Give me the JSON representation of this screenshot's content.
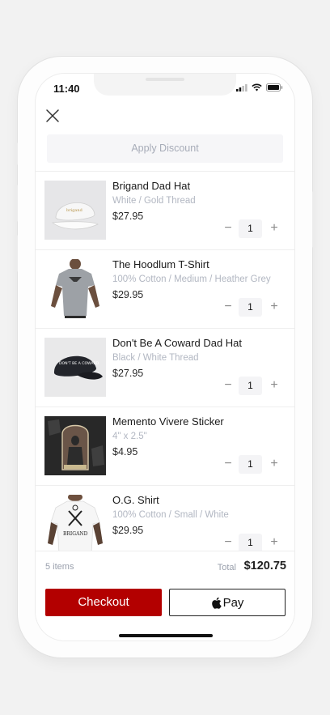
{
  "status": {
    "time": "11:40",
    "icons": [
      "signal-icon",
      "wifi-icon",
      "battery-icon"
    ]
  },
  "header": {
    "close_icon": "close-icon",
    "discount_label": "Apply Discount"
  },
  "cart": {
    "items": [
      {
        "name": "Brigand Dad Hat",
        "variant": "White / Gold Thread",
        "price": "$27.95",
        "quantity": "1",
        "minus": "−",
        "plus": "+",
        "image_text": "brigand"
      },
      {
        "name": "The Hoodlum T-Shirt",
        "variant": "100% Cotton / Medium / Heather Grey",
        "price": "$29.95",
        "quantity": "1",
        "minus": "−",
        "plus": "+"
      },
      {
        "name": "Don't Be A Coward Dad Hat",
        "variant": "Black / White Thread",
        "price": "$27.95",
        "quantity": "1",
        "minus": "−",
        "plus": "+",
        "image_text": "DON'T BE A COWARD"
      },
      {
        "name": "Memento Vivere Sticker",
        "variant": "4\" x 2.5\"",
        "price": "$4.95",
        "quantity": "1",
        "minus": "−",
        "plus": "+"
      },
      {
        "name": "O.G. Shirt",
        "variant": "100% Cotton / Small / White",
        "price": "$29.95",
        "quantity": "1",
        "minus": "−",
        "plus": "+",
        "image_text": "BRIGAND"
      }
    ]
  },
  "footer": {
    "count": "5 items",
    "total_label": "Total",
    "total_value": "$120.75",
    "checkout_label": "Checkout",
    "applepay_label": "Pay"
  },
  "colors": {
    "accent": "#b30000",
    "muted_text": "#b2b7c2"
  }
}
